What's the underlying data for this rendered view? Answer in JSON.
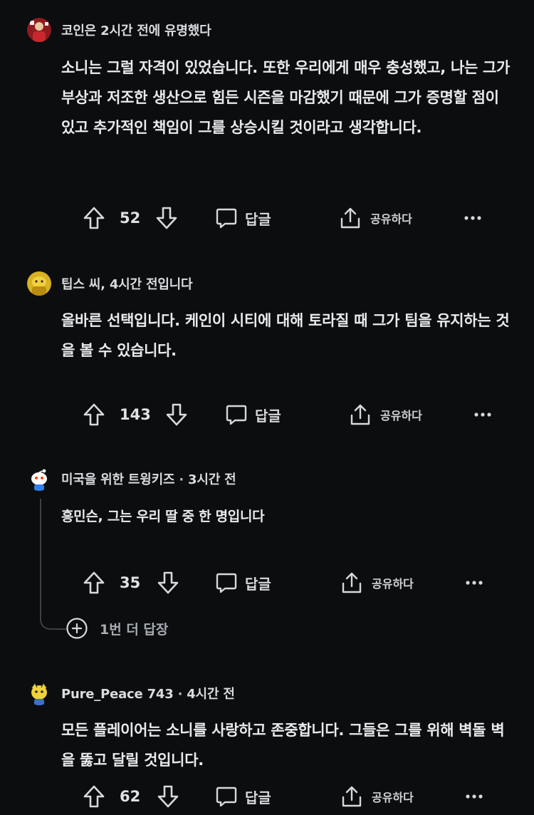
{
  "comments": [
    {
      "author": "코인은 2시간 전에 유명했다",
      "time": "",
      "text": "소니는 그럴 자격이 있었습니다. 또한 우리에게 매우 충성했고, 나는 그가 부상과 저조한 생산으로 힘든 시즌을 마감했기 때문에 그가 증명할 점이 있고 추가적인 책임이 그를 상승시킬 것이라고 생각합니다.",
      "score": "52",
      "reply": "답글",
      "share": "공유하다",
      "avatar_color": "#8e1b1f"
    },
    {
      "author": "팁스 씨, 4시간 전입니다",
      "time": "",
      "text": "올바른 선택입니다. 케인이 시티에 대해 토라질 때 그가 팀을 유지하는 것을 볼 수 있습니다.",
      "score": "143",
      "reply": "답글",
      "share": "공유하다",
      "avatar_color": "#d8b224"
    },
    {
      "author": "미국을 위한 트윙키즈",
      "dot": "·",
      "time": "3시간 전",
      "text": "흥민슨, 그는 우리 딸 중 한 명입니다",
      "score": "35",
      "reply": "답글",
      "share": "공유하다",
      "more_replies": "1번 더 답장",
      "avatar_color": "#ffffff"
    },
    {
      "author": "Pure_Peace 743",
      "dot": "·",
      "time": "4시간 전",
      "text": "모든 플레이어는 소니를 사랑하고 존중합니다. 그들은 그를 위해 벽돌 벽을 뚫고 달릴 것입니다.",
      "score": "62",
      "reply": "답글",
      "share": "공유하다",
      "avatar_color": "#f1d33a"
    }
  ],
  "icons": {
    "upvote": "arrow-up-icon",
    "downvote": "arrow-down-icon",
    "reply": "speech-bubble-icon",
    "share": "share-icon",
    "more": "more-horizontal-icon",
    "expand": "plus-circle-icon"
  }
}
